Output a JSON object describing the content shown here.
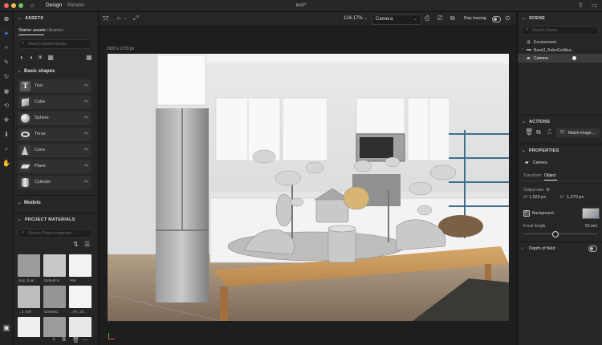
{
  "window": {
    "title": "test*",
    "tabs": [
      "Design",
      "Render"
    ],
    "active_tab": "Design"
  },
  "assets": {
    "header": "ASSETS",
    "subtabs": [
      "Starter assets",
      "Libraries"
    ],
    "search_placeholder": "Search Starter assets",
    "basic_shapes_label": "Basic shapes",
    "shapes": [
      "Text",
      "Cube",
      "Sphere",
      "Torus",
      "Cone",
      "Plane",
      "Cylinder"
    ],
    "models_label": "Models"
  },
  "project_materials": {
    "header": "PROJECT MATERIALS",
    "search_placeholder": "Search Project materials",
    "materials": [
      {
        "label": "sign_boar...",
        "color": "#9c9c9c"
      },
      {
        "label": "Default m...",
        "color": "#c8c8c8"
      },
      {
        "label": "Mat",
        "color": "#f2f2f2"
      },
      {
        "label": "...it_tree",
        "color": "#bdbdbd"
      },
      {
        "label": "lambert1",
        "color": "#959595"
      },
      {
        "label": "...PS_30...",
        "color": "#f4f4f4"
      },
      {
        "label": "",
        "color": "#eeeeee"
      },
      {
        "label": "",
        "color": "#9b9b9b"
      },
      {
        "label": "",
        "color": "#e8e8e8"
      }
    ]
  },
  "canvas": {
    "zoom": "124.17%",
    "camera": "Camera",
    "ray_tracing_label": "Ray tracing",
    "size_label": "1920 x 1279 px"
  },
  "scene": {
    "header": "SCENE",
    "search_placeholder": "Search Scene",
    "items": [
      "Environment",
      "BandJ_RubeGoldbur...",
      "Camera"
    ]
  },
  "actions": {
    "header": "ACTIONS",
    "match_image_label": "Match image..."
  },
  "properties": {
    "header": "PROPERTIES",
    "object_name": "Camera",
    "tabs": [
      "Transform",
      "Object"
    ],
    "active_tab": "Object",
    "output_size_label": "Output size",
    "w_label": "W",
    "w_value": "1,920 px",
    "h_label": "H",
    "h_value": "1,279 px",
    "background_label": "Background",
    "focal_length_label": "Focal length",
    "focal_length_value": "53 mm",
    "depth_of_field_label": "Depth of field"
  },
  "colors": {
    "accent": "#2d8ceb",
    "panel": "#262626",
    "close": "#ee6a5f",
    "minimize": "#f5be4f",
    "maximize": "#62c554"
  }
}
